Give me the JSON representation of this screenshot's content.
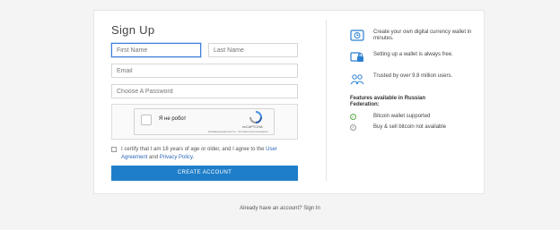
{
  "signup": {
    "title": "Sign Up",
    "first_name_placeholder": "First Name",
    "last_name_placeholder": "Last Name",
    "email_placeholder": "Email",
    "password_placeholder": "Choose A Password",
    "captcha": {
      "label": "Я не робот",
      "brand": "reCAPTCHA",
      "links": "Конфиденциальность - Условия использования"
    },
    "terms": {
      "prefix": "I certify that I am 18 years of age or older, and I agree to the",
      "user_agreement": "User Agreement",
      "middle": "and",
      "privacy_policy": "Privacy Policy",
      "suffix": "."
    },
    "create_button": "CREATE ACCOUNT"
  },
  "features": [
    {
      "icon": "wallet-screen-icon",
      "text": "Create your own digital currency wallet in minutes."
    },
    {
      "icon": "secure-wallet-icon",
      "text": "Setting up a wallet is always free."
    },
    {
      "icon": "users-group-icon",
      "text": "Trusted by over 9.8 million users."
    }
  ],
  "russia": {
    "heading": "Features available in Russian Federation:",
    "items": [
      {
        "icon": "check-circle-icon",
        "text": "Bitcoin wallet supported",
        "color": "#5aa84a"
      },
      {
        "icon": "x-circle-icon",
        "text": "Buy & sell bitcoin not available",
        "color": "#999999"
      }
    ]
  },
  "footer": {
    "prompt": "Already have an account?",
    "signin_link": "Sign In"
  },
  "colors": {
    "accent": "#1f7ec9",
    "feature_icon": "#2a7fd0"
  }
}
